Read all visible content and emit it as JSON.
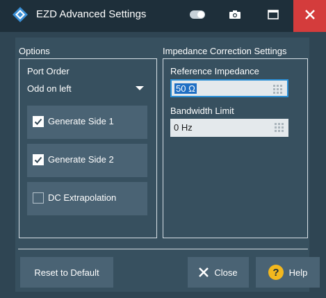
{
  "window": {
    "title": "EZD Advanced Settings"
  },
  "options": {
    "group_title": "Options",
    "port_order_label": "Port Order",
    "port_order_value": "Odd on left",
    "checkboxes": [
      {
        "label": "Generate Side 1",
        "checked": true
      },
      {
        "label": "Generate Side 2",
        "checked": true
      },
      {
        "label": "DC Extrapolation",
        "checked": false
      }
    ]
  },
  "impedance": {
    "group_title": "Impedance Correction Settings",
    "reference_label": "Reference Impedance",
    "reference_value": "50 Ω",
    "bandwidth_label": "Bandwidth Limit",
    "bandwidth_value": "0 Hz"
  },
  "footer": {
    "reset_label": "Reset to Default",
    "close_label": "Close",
    "help_label": "Help"
  },
  "colors": {
    "background": "#2f4553",
    "titlebar": "#1e2f3a",
    "button": "#4a6374",
    "close_red": "#d43c3c",
    "focus_blue": "#2b8fd6",
    "help_yellow": "#f3b81e"
  },
  "icons": {
    "logo": "rs-logo-icon",
    "toggle": "toggle-icon",
    "camera": "camera-icon",
    "maximize": "maximize-icon",
    "close": "close-icon",
    "keypad": "keypad-icon",
    "help": "help-icon"
  }
}
